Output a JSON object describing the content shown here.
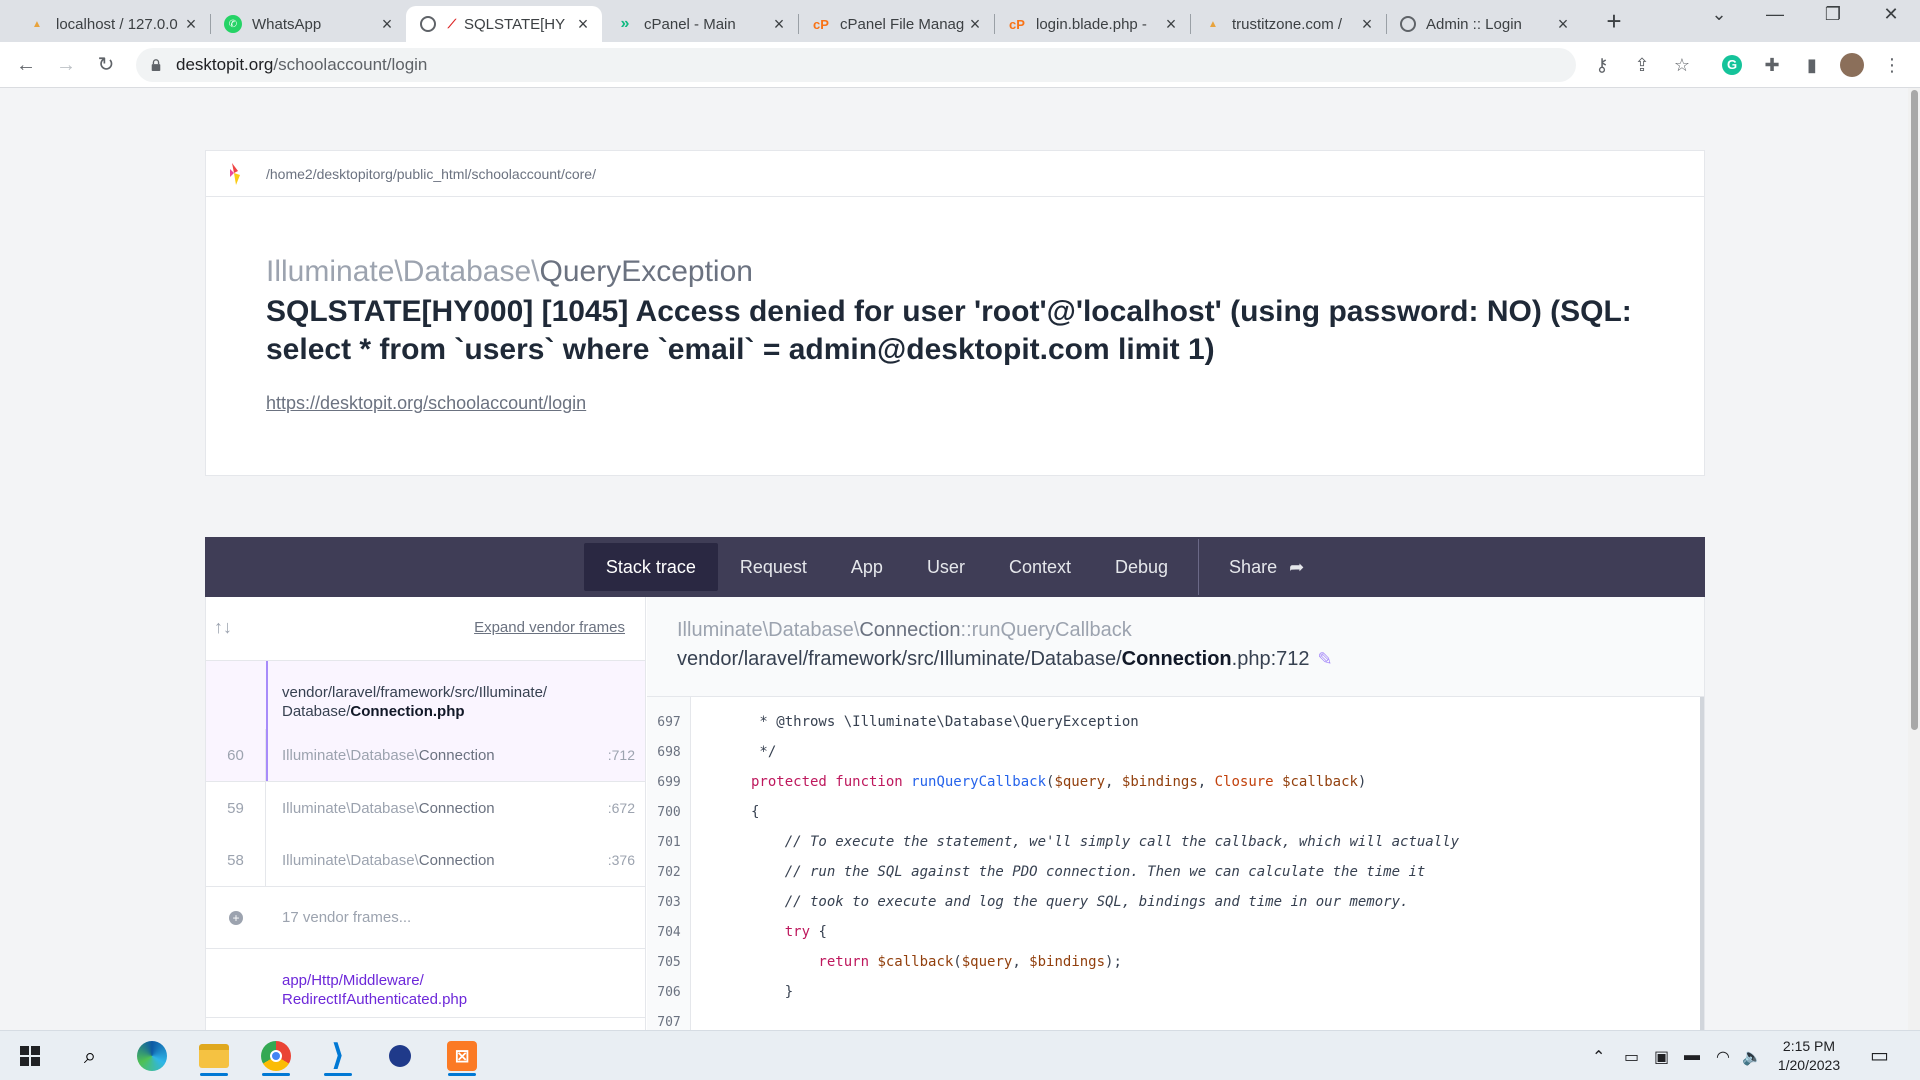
{
  "browser": {
    "tabs": [
      {
        "title": "localhost / 127.0.0",
        "icon": "phpmyadmin-icon",
        "active": false
      },
      {
        "title": "WhatsApp",
        "icon": "whatsapp-icon",
        "active": false
      },
      {
        "title": "SQLSTATE[HY",
        "icon": "globe-icon",
        "active": true
      },
      {
        "title": "cPanel - Main",
        "icon": "cpanel-arrow-icon",
        "active": false
      },
      {
        "title": "cPanel File Manag",
        "icon": "cpanel-icon",
        "active": false
      },
      {
        "title": "login.blade.php -",
        "icon": "cpanel-icon",
        "active": false
      },
      {
        "title": "trustitzone.com /",
        "icon": "phpmyadmin-icon",
        "active": false
      },
      {
        "title": "Admin :: Login",
        "icon": "globe-icon",
        "active": false
      }
    ],
    "url_host": "desktopit.org",
    "url_path": "/schoolaccount/login"
  },
  "error": {
    "root_path": "/home2/desktopitorg/public_html/schoolaccount/core/",
    "exception_ns": "Illuminate\\Database\\",
    "exception_name": "QueryException",
    "message": "SQLSTATE[HY000] [1045] Access denied for user 'root'@'localhost' (using password: NO) (SQL: select * from `users` where `email` = admin@desktopit.com limit 1)",
    "url": "https://desktopit.org/schoolaccount/login"
  },
  "nav_tabs": [
    "Stack trace",
    "Request",
    "App",
    "User",
    "Context",
    "Debug"
  ],
  "share_label": "Share",
  "frames": {
    "expand_label": "Expand vendor frames",
    "active_file_dir": "vendor/laravel/framework/src/Illuminate/ Database/",
    "active_file_name": "Connection.php",
    "rows": [
      {
        "num": "60",
        "ns": "Illuminate\\Database\\",
        "cls": "Connection",
        "line": ":712"
      },
      {
        "num": "59",
        "ns": "Illuminate\\Database\\",
        "cls": "Connection",
        "line": ":672"
      },
      {
        "num": "58",
        "ns": "Illuminate\\Database\\",
        "cls": "Connection",
        "line": ":376"
      }
    ],
    "vendor_label": "17 vendor frames...",
    "app_file_dir": "app/Http/Middleware/",
    "app_file_name": "RedirectIfAuthenticated.php"
  },
  "detail": {
    "ns": "Illuminate\\Database\\",
    "cls": "Connection",
    "method": "::runQueryCallback",
    "file_dir": "vendor/laravel/framework/src/Illuminate/Database/",
    "file_name": "Connection",
    "file_ext": ".php:712"
  },
  "code_line_numbers": [
    "697",
    "698",
    "699",
    "700",
    "701",
    "702",
    "703",
    "704",
    "705",
    "706",
    "707"
  ],
  "code_lines": {
    "l697": " * @throws \\Illuminate\\Database\\QueryException",
    "l698": " */",
    "l699_kw": "protected function ",
    "l699_fn": "runQueryCallback",
    "l699_a": "(",
    "l699_v1": "$query",
    "l699_b": ", ",
    "l699_v2": "$bindings",
    "l699_c": ", ",
    "l699_ty": "Closure",
    "l699_d": " ",
    "l699_v3": "$callback",
    "l699_e": ")",
    "l700": "{",
    "l701": "    // To execute the statement, we'll simply call the callback, which will actually",
    "l702": "    // run the SQL against the PDO connection. Then we can calculate the time it",
    "l703": "    // took to execute and log the query SQL, bindings and time in our memory.",
    "l704_kw": "    try",
    "l704_r": " {",
    "l705_kw": "        return ",
    "l705_v1": "$callback",
    "l705_a": "(",
    "l705_v2": "$query",
    "l705_b": ", ",
    "l705_v3": "$bindings",
    "l705_c": ");",
    "l706": "    }"
  },
  "taskbar": {
    "time": "2:15 PM",
    "date": "1/20/2023"
  },
  "colors": {
    "nav_bar": "#3f3d56",
    "accent": "#a78bfa"
  }
}
